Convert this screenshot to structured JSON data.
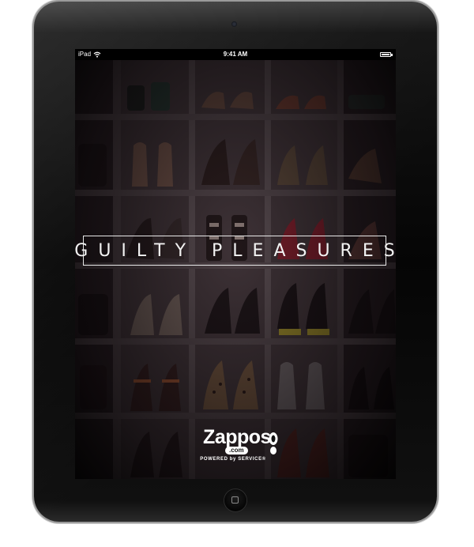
{
  "status_bar": {
    "carrier": "iPad",
    "time": "9:41 AM",
    "wifi_icon": "wifi-icon",
    "battery_icon": "battery-icon"
  },
  "hero": {
    "headline": "GUILTY PLEASURES",
    "background": "shoe shelving photo"
  },
  "logo": {
    "wordmark": "Zappos",
    "domain_badge": ".com",
    "tagline": "POWERED by SERVICE®"
  },
  "device": {
    "home_button_icon": "home-square-icon"
  },
  "colors": {
    "bezel": "#0a0a0a",
    "text": "#f2f2f2",
    "frame": "#e8e8e8"
  }
}
